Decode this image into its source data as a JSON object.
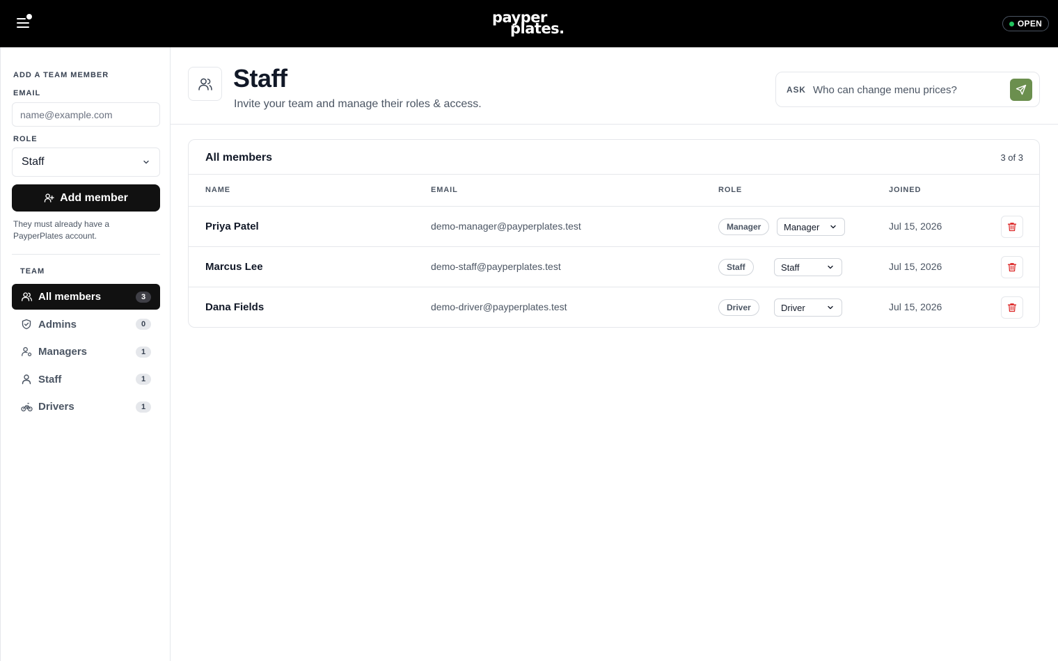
{
  "topbar": {
    "logo_line1": "payper",
    "logo_line2": "plates.",
    "status_label": "OPEN",
    "status_color": "#22c55e"
  },
  "sidebar": {
    "add_section_label": "ADD A TEAM MEMBER",
    "email_label": "EMAIL",
    "email_placeholder": "name@example.com",
    "email_value": "",
    "role_label": "ROLE",
    "role_value": "Staff",
    "add_button_label": "Add member",
    "hint": "They must already have a PayperPlates account.",
    "team_label": "TEAM",
    "items": [
      {
        "label": "All members",
        "count": "3",
        "icon": "users-icon",
        "active": true
      },
      {
        "label": "Admins",
        "count": "0",
        "icon": "shield-icon",
        "active": false
      },
      {
        "label": "Managers",
        "count": "1",
        "icon": "user-cog-icon",
        "active": false
      },
      {
        "label": "Staff",
        "count": "1",
        "icon": "user-icon",
        "active": false
      },
      {
        "label": "Drivers",
        "count": "1",
        "icon": "bike-icon",
        "active": false
      }
    ]
  },
  "header": {
    "title": "Staff",
    "subtitle": "Invite your team and manage their roles & access.",
    "ask_label": "ASK",
    "ask_placeholder": "Who can change menu prices?",
    "ask_accent": "#6b8f4e"
  },
  "members": {
    "title": "All members",
    "count_text": "3 of 3",
    "columns": [
      "NAME",
      "EMAIL",
      "ROLE",
      "JOINED"
    ],
    "rows": [
      {
        "name": "Priya Patel",
        "email": "demo-manager@payperplates.test",
        "role_badge": "Manager",
        "role_select": "Manager",
        "joined": "Jul 15, 2026"
      },
      {
        "name": "Marcus Lee",
        "email": "demo-staff@payperplates.test",
        "role_badge": "Staff",
        "role_select": "Staff",
        "joined": "Jul 15, 2026"
      },
      {
        "name": "Dana Fields",
        "email": "demo-driver@payperplates.test",
        "role_badge": "Driver",
        "role_select": "Driver",
        "joined": "Jul 15, 2026"
      }
    ],
    "delete_color": "#dc2626"
  }
}
